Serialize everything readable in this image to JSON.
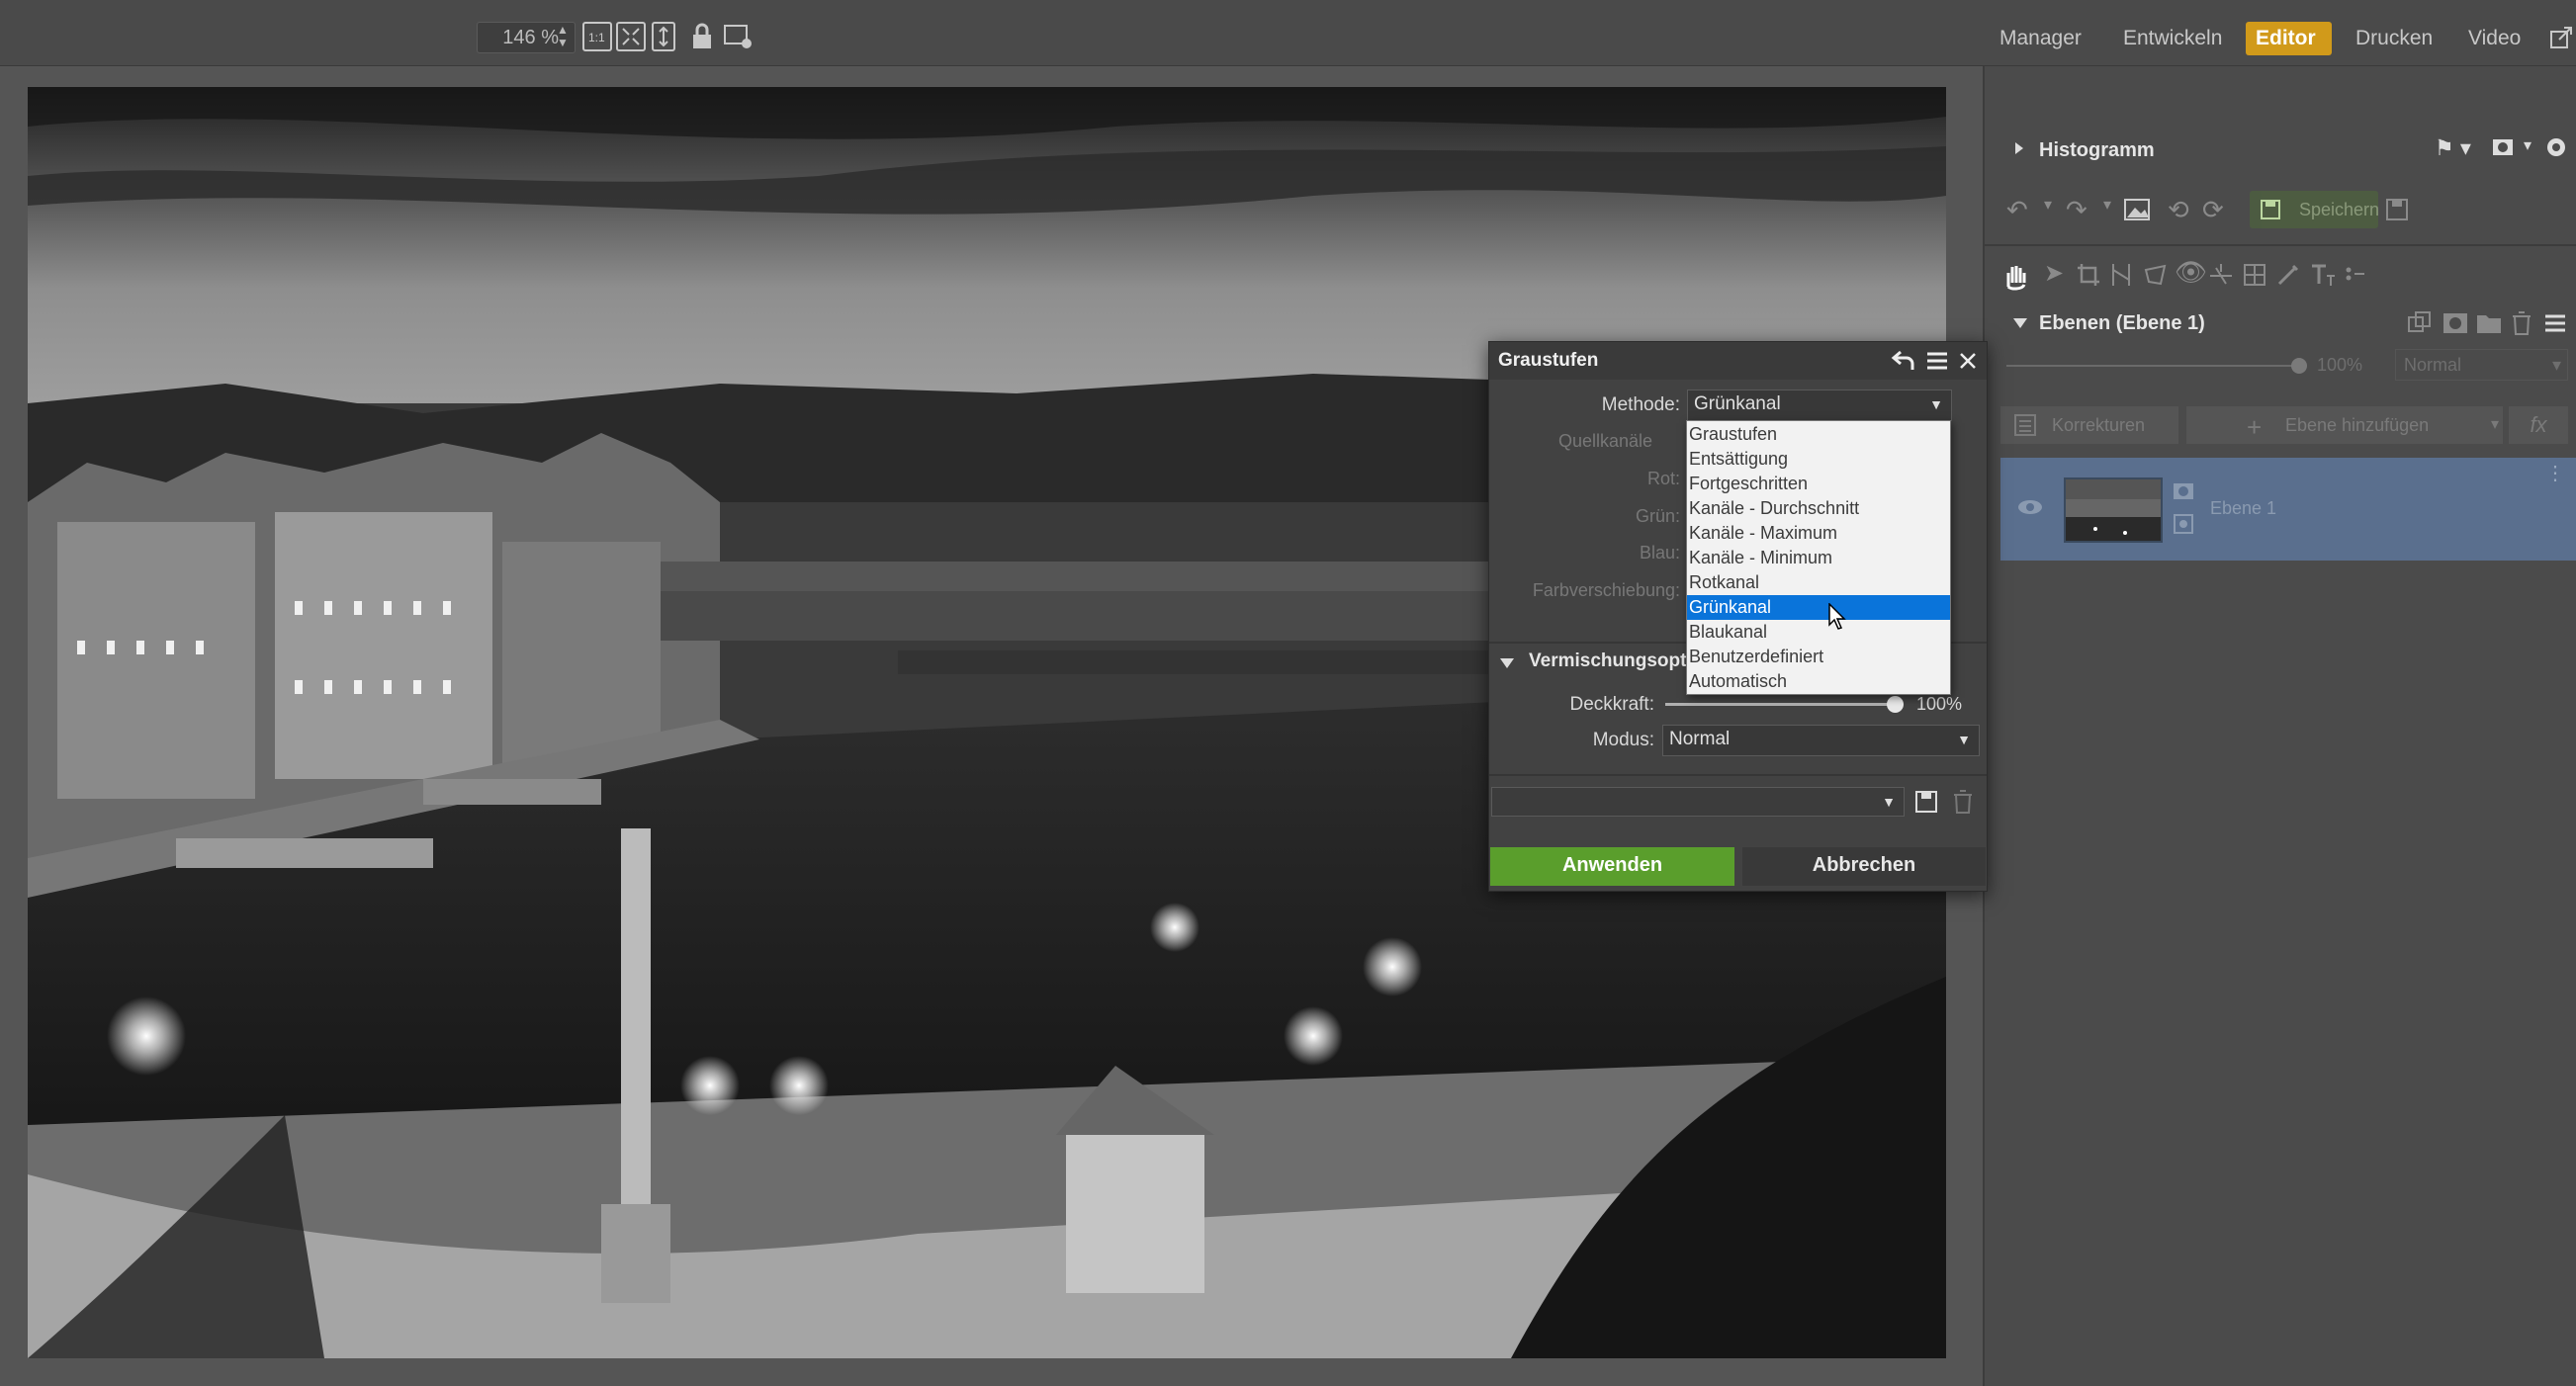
{
  "topbar": {
    "zoom": "146 %",
    "modes": [
      "Manager",
      "Entwickeln",
      "Editor",
      "Drucken",
      "Video"
    ]
  },
  "right_panel": {
    "histogram_title": "Histogramm",
    "save_label": "Speichern",
    "layers_title": "Ebenen (Ebene 1)",
    "opacity": "100%",
    "blend_mode": "Normal",
    "corrections_label": "Korrekturen",
    "add_layer_label": "Ebene hinzufügen",
    "fx_label": "fx",
    "layer_name": "Ebene 1"
  },
  "dialog": {
    "title": "Graustufen",
    "method_label": "Methode:",
    "method_value": "Grünkanal",
    "source_channels_label": "Quellkanäle",
    "red_label": "Rot:",
    "green_label": "Grün:",
    "blue_label": "Blau:",
    "color_shift_label": "Farbverschiebung:",
    "blend_section": "Vermischungsopti",
    "opacity_label": "Deckkraft:",
    "opacity_value": "100%",
    "opacity_fraction": 1.0,
    "mode_label": "Modus:",
    "mode_value": "Normal",
    "apply_label": "Anwenden",
    "cancel_label": "Abbrechen",
    "options": [
      "Graustufen",
      "Entsättigung",
      "Fortgeschritten",
      "Kanäle - Durchschnitt",
      "Kanäle - Maximum",
      "Kanäle - Minimum",
      "Rotkanal",
      "Grünkanal",
      "Blaukanal",
      "Benutzerdefiniert",
      "Automatisch"
    ],
    "selected_index": 7
  },
  "colors": {
    "editor_tab": "#d19a1a",
    "apply_button": "#5a9e2c",
    "selection": "#0a74da",
    "layer_selected": "#5a6f8e"
  }
}
